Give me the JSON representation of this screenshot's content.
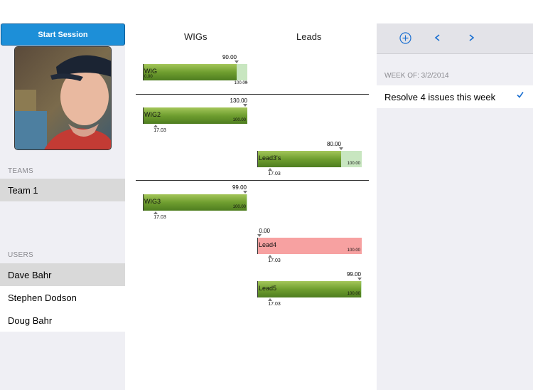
{
  "sidebar": {
    "start_session": "Start Session",
    "teams_label": "TEAMS",
    "teams": [
      "Team 1"
    ],
    "users_label": "USERS",
    "users": [
      "Dave Bahr",
      "Stephen Dodson",
      "Doug Bahr"
    ]
  },
  "columns": {
    "wigs": "WIGs",
    "leads": "Leads"
  },
  "gauges": [
    {
      "name": "WIG",
      "target_label": "90.00",
      "small_label": "0.00",
      "max_label": "100.00",
      "bottom_label": "",
      "value_pct": 0.9,
      "color": "green-partial"
    },
    {
      "name": "WIG2",
      "target_label": "130.00",
      "small_label": "",
      "max_label": "100.00",
      "bottom_label": "17.03",
      "value_pct": 1.0,
      "color": "green"
    },
    {
      "name": "Lead3's",
      "target_label": "80.00",
      "small_label": "",
      "max_label": "100.00",
      "bottom_label": "17.03",
      "value_pct": 0.8,
      "color": "green-partial"
    },
    {
      "name": "WIG3",
      "target_label": "99.00",
      "small_label": "",
      "max_label": "100.00",
      "bottom_label": "17.03",
      "value_pct": 0.99,
      "color": "green"
    },
    {
      "name": "Lead4",
      "target_label": "0.00",
      "small_label": "",
      "max_label": "100.00",
      "bottom_label": "17.03",
      "value_pct": 0.0,
      "color": "red"
    },
    {
      "name": "Lead5",
      "target_label": "99.00",
      "small_label": "",
      "max_label": "100.00",
      "bottom_label": "17.03",
      "value_pct": 0.99,
      "color": "green"
    }
  ],
  "right": {
    "week_label": "WEEK OF: 3/2/2014",
    "goals": [
      "Resolve 4 issues this week"
    ],
    "icons": [
      "add-icon",
      "prev-icon",
      "next-icon",
      "checkmark-icon"
    ]
  },
  "colors": {
    "accent": "#1d8fd8",
    "green": "#6f9e2f",
    "red": "#f7a1a1"
  }
}
